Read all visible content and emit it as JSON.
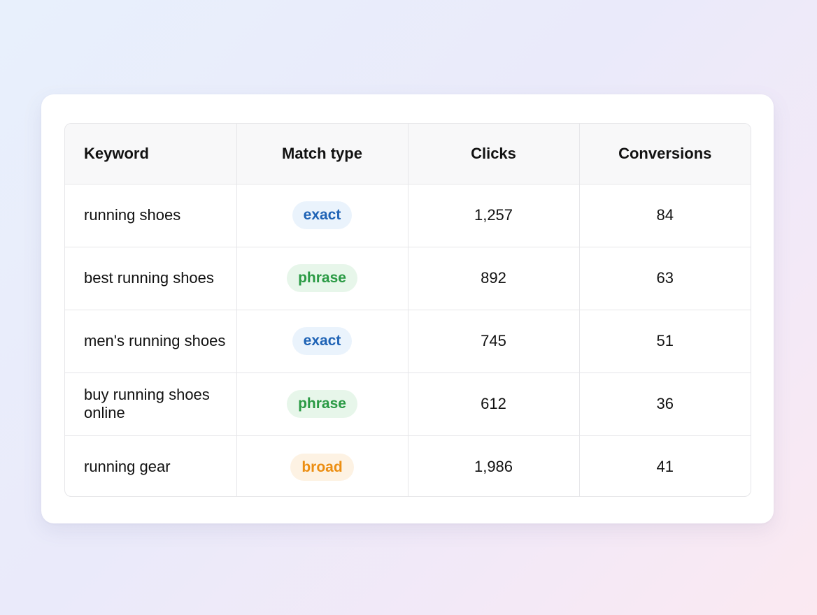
{
  "table": {
    "headers": {
      "keyword": "Keyword",
      "match_type": "Match type",
      "clicks": "Clicks",
      "conversions": "Conversions"
    },
    "rows": [
      {
        "keyword": "running shoes",
        "match_type": "exact",
        "clicks": "1,257",
        "conversions": "84"
      },
      {
        "keyword": "best running shoes",
        "match_type": "phrase",
        "clicks": "892",
        "conversions": "63"
      },
      {
        "keyword": "men's running shoes",
        "match_type": "exact",
        "clicks": "745",
        "conversions": "51"
      },
      {
        "keyword": "buy running shoes online",
        "match_type": "phrase",
        "clicks": "612",
        "conversions": "36"
      },
      {
        "keyword": "running gear",
        "match_type": "broad",
        "clicks": "1,986",
        "conversions": "41"
      }
    ]
  },
  "colors": {
    "exact": "#1f63b5",
    "phrase": "#2a9a44",
    "broad": "#ec8e12"
  }
}
